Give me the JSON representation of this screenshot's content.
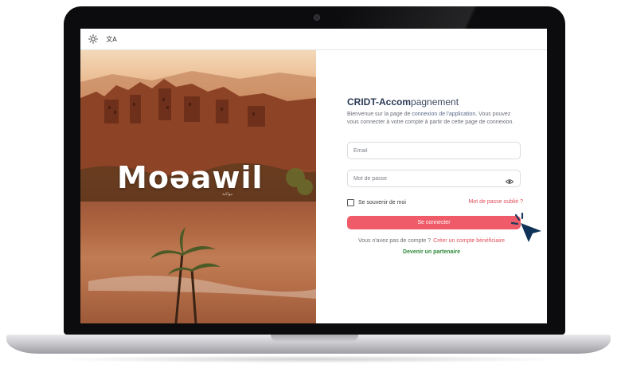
{
  "topbar": {
    "icons": [
      "sun-icon",
      "translate-icon"
    ],
    "translate_glyph": "文A"
  },
  "brand": {
    "logo_text": "Moǝawil",
    "logo_sub": "مواكبة"
  },
  "login": {
    "title_main": "CRIDT-Accom",
    "title_accent": "pagnement",
    "description_pre": "Bienvenue sur la page de ",
    "description_hl": "connexion de l'application",
    "description_post": ". Vous pouvez vous connecter à votre compte à partir de cette page de connexion.",
    "email_placeholder": "Email",
    "email_value": "",
    "password_placeholder": "Mot de passe",
    "password_value": "",
    "remember_label": "Se souvenir de moi",
    "remember_checked": false,
    "forgot_label": "Mot de passe oublié ?",
    "submit_label": "Se connecter",
    "no_account_text": "Vous n'avez pas de compte ?",
    "create_account_link": "Créer un compte bénéficiaire",
    "partner_link": "Devenir un partenaire"
  },
  "colors": {
    "accent": "#ef5b68",
    "link_red": "#e0505a",
    "partner_green": "#2e8a3a",
    "title": "#2b3a55"
  }
}
